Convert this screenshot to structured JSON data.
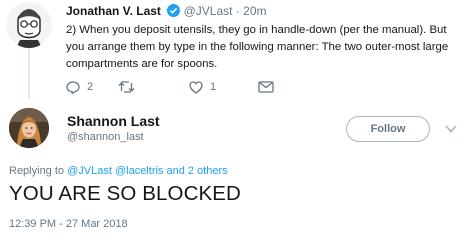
{
  "parent_tweet": {
    "author_name": "Jonathan V. Last",
    "author_handle": "@JVLast",
    "separator": "·",
    "time": "20m",
    "text": "2) When you deposit utensils, they go in handle-down (per the manual). But you arrange them by type in the following manner: The two outer-most large compartments are for spoons.",
    "reply_count": "2",
    "retweet_count": "",
    "like_count": "1"
  },
  "main_tweet": {
    "author_name": "Shannon Last",
    "author_handle": "@shannon_last",
    "follow_label": "Follow",
    "replying_prefix": "Replying to",
    "replying_user_1": "@JVLast",
    "replying_user_2": "@laceltris",
    "replying_suffix": "and 2 others",
    "text": "YOU ARE SO BLOCKED",
    "timestamp": "12:39 PM - 27 Mar 2018"
  },
  "colors": {
    "accent": "#1da1f2",
    "muted": "#657786",
    "text": "#14171a"
  },
  "icons": {
    "verified": "verified-badge-icon",
    "reply": "reply-icon",
    "retweet": "retweet-icon",
    "like": "heart-icon",
    "messages": "envelope-icon",
    "more": "chevron-down-icon"
  }
}
